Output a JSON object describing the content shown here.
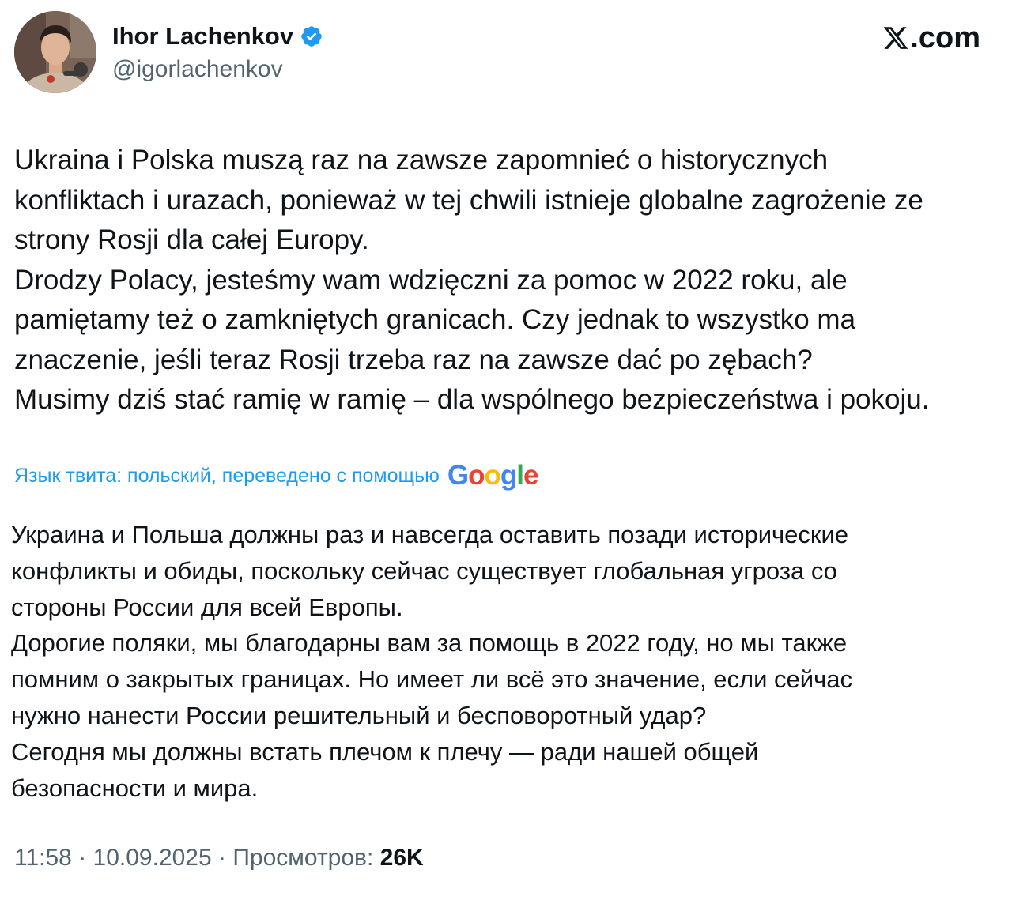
{
  "author": {
    "display_name": "Ihor Lachenkov",
    "handle": "@igorlachenkov",
    "verified": true,
    "verified_icon": "verified-badge-icon"
  },
  "brand": {
    "label": ".com",
    "logo_icon": "x-logo-icon"
  },
  "tweet": {
    "lines": [
      "Ukraina i Polska muszą raz na zawsze zapomnieć o historycznych",
      "konfliktach i urazach, ponieważ w tej chwili istnieje globalne zagrożenie ze",
      "strony Rosji dla całej Europy.",
      "Drodzy Polacy, jesteśmy wam wdzięczni za pomoc w 2022 roku, ale",
      "pamiętamy też o zamkniętych granicach. Czy jednak to wszystko ma",
      "znaczenie, jeśli teraz Rosji trzeba raz na zawsze dać po zębach?",
      "Musimy dziś stać ramię w ramię – dla wspólnego bezpieczeństwa i pokoju."
    ]
  },
  "translation": {
    "label": "Язык твита: польский, переведено с помощью",
    "provider": "Google",
    "lines": [
      "Украина и Польша должны раз и навсегда оставить позади исторические",
      "конфликты и обиды, поскольку сейчас существует глобальная угроза со",
      "стороны России для всей Европы.",
      "Дорогие поляки, мы благодарны вам за помощь в 2022 году, но мы также",
      "помним о закрытых границах. Но имеет ли всё это значение, если сейчас",
      "нужно нанести России решительный и бесповоротный удар?",
      "Сегодня мы должны встать плечом к плечу — ради нашей общей",
      "безопасности и мира."
    ]
  },
  "meta": {
    "time": "11:58",
    "separator": " · ",
    "date": "10.09.2025",
    "views_label": "Просмотров:",
    "views_count": "26K"
  },
  "colors": {
    "text": "#0f1419",
    "secondary": "#536471",
    "link": "#1d9bf0",
    "verified": "#1d9bf0",
    "google_blue": "#4285F4",
    "google_red": "#EA4335",
    "google_yellow": "#FBBC05",
    "google_green": "#34A853"
  }
}
